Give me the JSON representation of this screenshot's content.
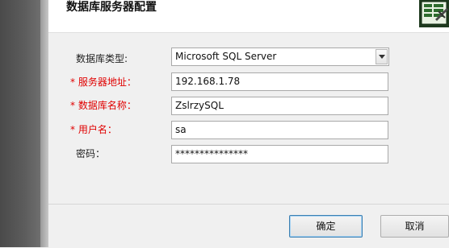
{
  "dialog": {
    "title": "数据库服务器配置"
  },
  "form": {
    "db_type": {
      "label": "数据库类型:",
      "value": "Microsoft SQL Server"
    },
    "server": {
      "required_mark": "*",
      "label": "服务器地址：",
      "value": "192.168.1.78"
    },
    "db_name": {
      "required_mark": "*",
      "label": "数据库名称：",
      "value": "ZslrzySQL"
    },
    "username": {
      "required_mark": "*",
      "label": "用户名：",
      "value": "sa"
    },
    "password": {
      "label": "密码：",
      "value": "***************"
    }
  },
  "buttons": {
    "ok": "确定",
    "cancel": "取消"
  },
  "colors": {
    "required": "#e00000",
    "primary_border": "#3c7fb1"
  },
  "icons": {
    "header": "database-config-icon",
    "dropdown": "chevron-down-icon"
  }
}
